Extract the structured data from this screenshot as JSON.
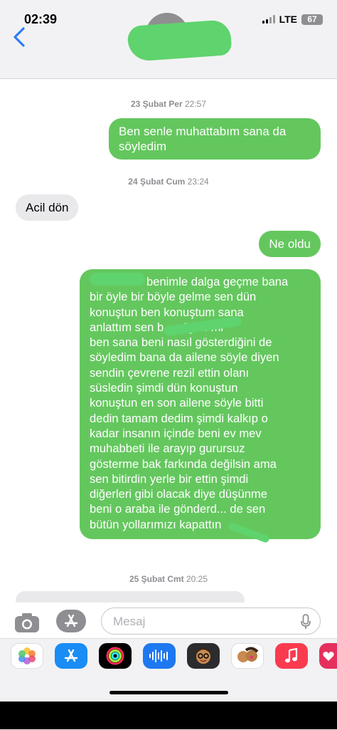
{
  "status": {
    "time": "02:39",
    "network": "LTE",
    "battery": "67"
  },
  "colors": {
    "sent": "#64c75e",
    "received": "#e9e9eb",
    "accent": "#2e7cf6"
  },
  "conversation": {
    "ts1": {
      "date": "23 Şubat Per",
      "time": "22:57"
    },
    "m1": "Ben senle muhattabım sana da söyledim",
    "ts2": {
      "date": "24 Şubat Cum",
      "time": "23:24"
    },
    "m2": "Acil dön",
    "m3": "Ne oldu",
    "m4_lines": [
      "benimle dalga geçme bana",
      "bir öyle bir böyle gelme sen dün",
      "konuştun ben konuştum sana",
      "anlattım sen b... söyl... mi",
      "ben sana beni nasıl gösterdiğini de",
      "söyledim bana da ailene söyle diyen",
      "sendin çevrene rezil ettin olanı",
      "süsledin şimdi dün konuştun",
      "konuştun en son ailene söyle bitti",
      "dedin tamam dedim şimdi kalkıp o",
      "kadar insanın içinde beni ev mev",
      "muhabbeti ile arayıp gurursuz",
      "gösterme bak farkında değilsin ama",
      "sen bitirdin yerle bir ettin şimdi",
      "diğerleri gibi olacak diye düşünme",
      "beni o araba ile gönderd... de sen",
      "bütün yollarımızı kapattın"
    ],
    "ts3": {
      "date": "25 Şubat Cmt",
      "time": "20:25"
    }
  },
  "input": {
    "placeholder": "Mesaj"
  },
  "icons": {
    "back": "chevron-left-icon",
    "camera": "camera-icon",
    "apps": "app-store-icon",
    "mic": "microphone-icon"
  },
  "app_drawer": [
    "photos",
    "app-store",
    "activity",
    "audio-message",
    "memoji",
    "memoji-stickers",
    "music",
    "digital-touch"
  ]
}
